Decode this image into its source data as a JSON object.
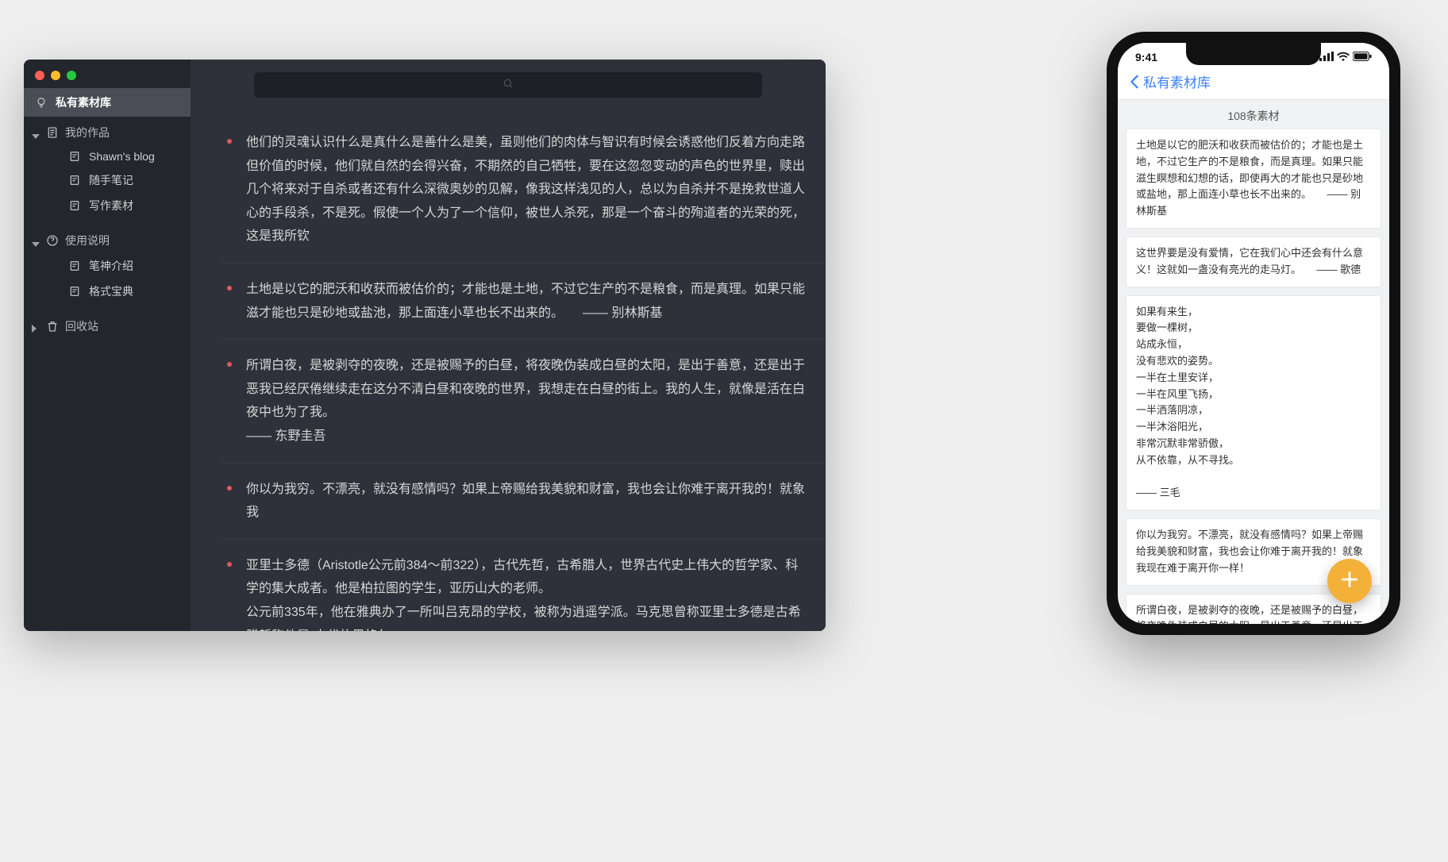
{
  "desktop": {
    "sidebar": {
      "primary": {
        "label": "私有素材库"
      },
      "groups": [
        {
          "label": "我的作品",
          "expanded": true,
          "children": [
            "Shawn's blog",
            "随手笔记",
            "写作素材"
          ]
        },
        {
          "label": "使用说明",
          "expanded": true,
          "children": [
            "笔神介绍",
            "格式宝典"
          ]
        },
        {
          "label": "回收站",
          "expanded": false,
          "children": []
        }
      ]
    },
    "search_placeholder": "",
    "notes": [
      "他们的灵魂认识什么是真什么是善什么是美，虽则他们的肉体与智识有时候会诱惑他们反着方向走路 但价值的时候，他们就自然的会得兴奋，不期然的自己牺牲，要在这忽忽变动的声色的世界里，赎出几个将来对于自杀或者还有什么深微奥妙的见解，像我这样浅见的人，总以为自杀并不是挽救世道人心的手段杀，不是死。假使一个人为了一个信仰，被世人杀死，那是一个奋斗的殉道者的光荣的死，这是我所钦",
      "土地是以它的肥沃和收获而被估价的；才能也是土地，不过它生产的不是粮食，而是真理。如果只能滋才能也只是砂地或盐池，那上面连小草也长不出来的。　　—— 别林斯基",
      "所谓白夜，是被剥夺的夜晚，还是被赐予的白昼，将夜晚伪装成白昼的太阳，是出于善意，还是出于恶我已经厌倦继续走在这分不清白昼和夜晚的世界，我想走在白昼的街上。我的人生，就像是活在白夜中也为了我。\n—— 东野圭吾",
      "你以为我穷。不漂亮，就没有感情吗？如果上帝赐给我美貌和财富，我也会让你难于离开我的！就象我",
      "亚里士多德（Aristotle公元前384～前322），古代先哲，古希腊人，世界古代史上伟大的哲学家、科学的集大成者。他是柏拉图的学生，亚历山大的老师。\n公元前335年，他在雅典办了一所叫吕克昂的学校，被称为逍遥学派。马克思曾称亚里士多德是古希腊哲称他是\"古代的黑格尔\"。"
    ]
  },
  "phone": {
    "status_time": "9:41",
    "nav_title": "私有素材库",
    "count_label": "108条素材",
    "cards": [
      "土地是以它的肥沃和收获而被估价的；才能也是土地，不过它生产的不是粮食，而是真理。如果只能滋生瞑想和幻想的话，即使再大的才能也只是砂地或盐地，那上面连小草也长不出来的。　　—— 别林斯基",
      "这世界要是没有爱情，它在我们心中还会有什么意义！这就如一盏没有亮光的走马灯。　　—— 歌德",
      "如果有来生，\n要做一棵树，\n站成永恒，\n没有悲欢的姿势。\n一半在土里安详，\n一半在风里飞扬，\n一半洒落阴凉，\n一半沐浴阳光，\n非常沉默非常骄傲，\n从不依靠，从不寻找。\n\n—— 三毛",
      "你以为我穷。不漂亮，就没有感情吗？如果上帝赐给我美貌和财富，我也会让你难于离开我的！就象我现在难于离开你一样！",
      "所谓白夜，是被剥夺的夜晚，还是被赐予的白昼，将夜晚伪装成白昼的太阳，是出于善意，还是出于恶意呢？我一直在思考这些，总之我已经厌倦继续走在这分不清白昼和夜晚的世界，我想走在白昼的街上。我的人生，就像是活在白夜中。结束吧，所有这一切为了你，也为了我。\n\n—— 东野圭吾"
    ]
  }
}
